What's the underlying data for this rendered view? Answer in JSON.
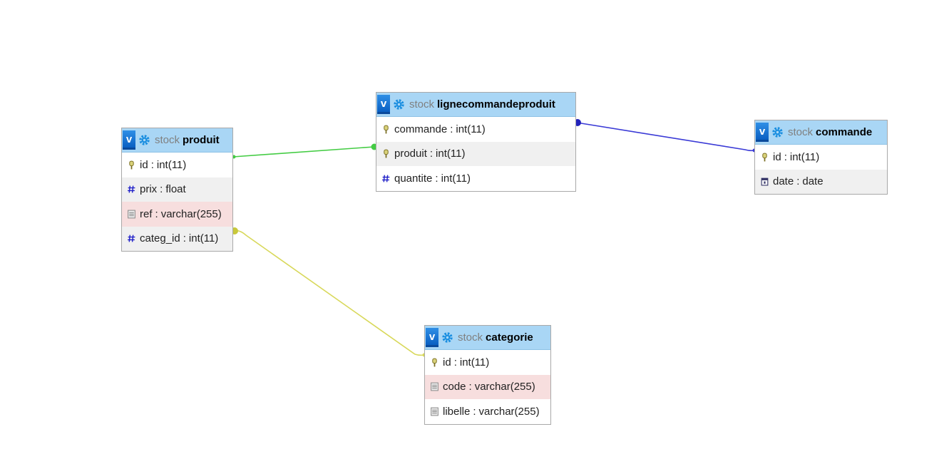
{
  "colors": {
    "header_bg": "#a9d6f5",
    "toggle_blue": "#0a5fc2",
    "key_icon": "#8a7d2c",
    "hash_icon": "#2020c8",
    "link_green": "#44cc44",
    "link_blue": "#3a3ad6",
    "link_yellow": "#d8d85a",
    "row_grey": "#f0f0f0",
    "row_pink": "#f7dede"
  },
  "toggle_label": "v",
  "separator": ":",
  "tables": [
    {
      "id": "produit",
      "schema": "stock",
      "name": "produit",
      "columns": [
        {
          "name": "id",
          "type": "int(11)",
          "icon": "key-icon",
          "shade": "white"
        },
        {
          "name": "prix",
          "type": "float",
          "icon": "hash-icon",
          "shade": "grey"
        },
        {
          "name": "ref",
          "type": "varchar(255)",
          "icon": "text-icon",
          "shade": "pink"
        },
        {
          "name": "categ_id",
          "type": "int(11)",
          "icon": "hash-icon",
          "shade": "grey"
        }
      ]
    },
    {
      "id": "lignecommandeproduit",
      "schema": "stock",
      "name": "lignecommandeproduit",
      "columns": [
        {
          "name": "commande",
          "type": "int(11)",
          "icon": "key-icon",
          "shade": "white"
        },
        {
          "name": "produit",
          "type": "int(11)",
          "icon": "key-icon",
          "shade": "grey"
        },
        {
          "name": "quantite",
          "type": "int(11)",
          "icon": "hash-icon",
          "shade": "white"
        }
      ]
    },
    {
      "id": "commande",
      "schema": "stock",
      "name": "commande",
      "columns": [
        {
          "name": "id",
          "type": "int(11)",
          "icon": "key-icon",
          "shade": "white"
        },
        {
          "name": "date",
          "type": "date",
          "icon": "calendar-icon",
          "shade": "grey"
        }
      ]
    },
    {
      "id": "categorie",
      "schema": "stock",
      "name": "categorie",
      "columns": [
        {
          "name": "id",
          "type": "int(11)",
          "icon": "key-icon",
          "shade": "white"
        },
        {
          "name": "code",
          "type": "varchar(255)",
          "icon": "text-icon",
          "shade": "pink"
        },
        {
          "name": "libelle",
          "type": "varchar(255)",
          "icon": "text-icon",
          "shade": "white"
        }
      ]
    }
  ],
  "relations": [
    {
      "from": "lignecommandeproduit.produit",
      "to": "produit.id",
      "color": "#44cc44"
    },
    {
      "from": "lignecommandeproduit.commande",
      "to": "commande.id",
      "color": "#3a3ad6"
    },
    {
      "from": "produit.categ_id",
      "to": "categorie.id",
      "color": "#d8d85a"
    }
  ]
}
